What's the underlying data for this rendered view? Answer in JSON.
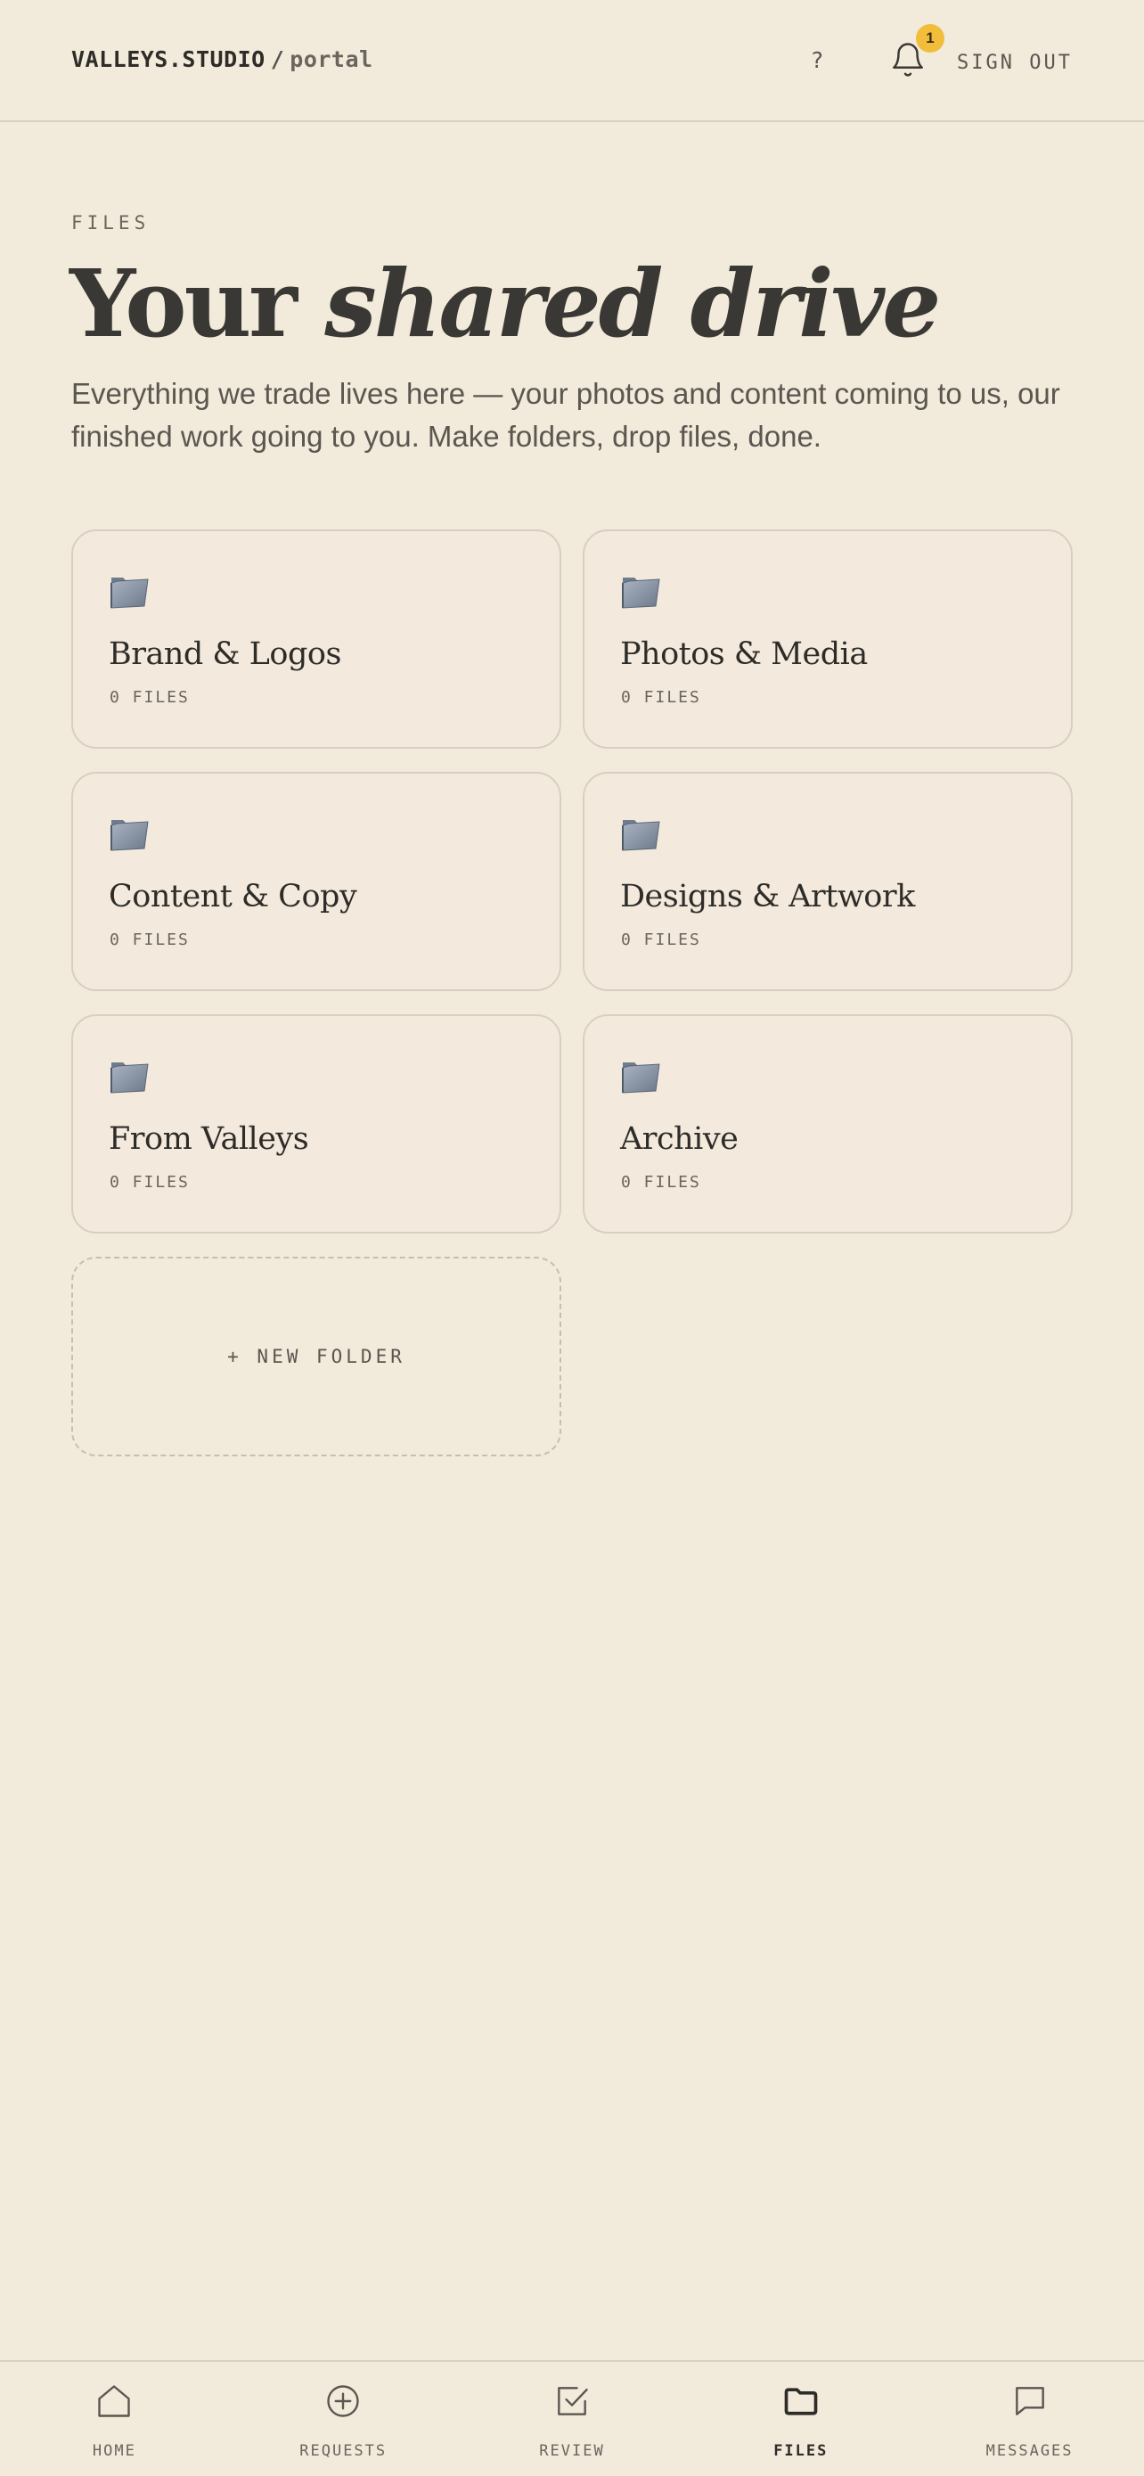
{
  "header": {
    "brand": "VALLEYS.STUDIO",
    "separator": "/",
    "brand_sub": "portal",
    "help_label": "?",
    "notification_count": "1",
    "sign_out_label": "SIGN OUT"
  },
  "intro": {
    "eyebrow": "FILES",
    "title_plain": "Your",
    "title_em": "shared drive",
    "lead": "Everything we trade lives here — your photos and content coming to us, our finished work going to you. Make folders, drop files, done."
  },
  "folders": [
    {
      "name": "Brand & Logos",
      "count": "0 FILES",
      "icon": "folder-icon"
    },
    {
      "name": "Photos & Media",
      "count": "0 FILES",
      "icon": "folder-icon"
    },
    {
      "name": "Content & Copy",
      "count": "0 FILES",
      "icon": "folder-icon"
    },
    {
      "name": "Designs & Artwork",
      "count": "0 FILES",
      "icon": "folder-icon"
    },
    {
      "name": "From Valleys",
      "count": "0 FILES",
      "icon": "folder-icon"
    },
    {
      "name": "Archive",
      "count": "0 FILES",
      "icon": "folder-icon"
    }
  ],
  "new_folder_label": "+ NEW FOLDER",
  "nav": [
    {
      "label": "HOME",
      "icon": "home-icon",
      "active": false
    },
    {
      "label": "REQUESTS",
      "icon": "plus-circle-icon",
      "active": false
    },
    {
      "label": "REVIEW",
      "icon": "check-square-icon",
      "active": false
    },
    {
      "label": "FILES",
      "icon": "folder-outline-icon",
      "active": true
    },
    {
      "label": "MESSAGES",
      "icon": "message-icon",
      "active": false
    }
  ],
  "colors": {
    "background": "#f2eada",
    "badge": "#f3bd3c",
    "card_border": "#d9cfc0",
    "text": "#3a3834"
  }
}
